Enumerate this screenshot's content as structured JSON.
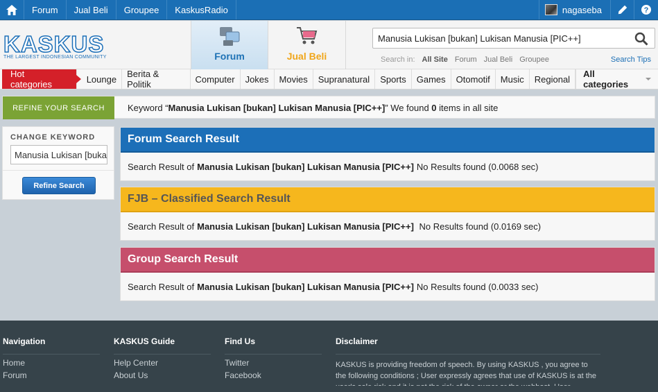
{
  "topbar": {
    "links": [
      "Forum",
      "Jual Beli",
      "Groupee",
      "KaskusRadio"
    ],
    "username": "nagaseba"
  },
  "header": {
    "logo_text": "KASKUS",
    "logo_tagline": "THE LARGEST INDONESIAN COMMUNITY",
    "tabs": [
      {
        "label": "Forum"
      },
      {
        "label": "Jual Beli"
      }
    ],
    "search": {
      "query": "Manusia Lukisan [bukan] Lukisan Manusia [PIC++]",
      "search_in_label": "Search in:",
      "options": [
        "All Site",
        "Forum",
        "Jual Beli",
        "Groupee"
      ],
      "tips": "Search Tips"
    }
  },
  "categories": {
    "hot": "Hot categories",
    "items": [
      "Lounge",
      "Berita & Politik",
      "Computer",
      "Jokes",
      "Movies",
      "Supranatural",
      "Sports",
      "Games",
      "Otomotif",
      "Music",
      "Regional"
    ],
    "all": "All categories"
  },
  "refine": {
    "label": "REFINE YOUR SEARCH",
    "prefix": "Keyword “",
    "keyword": "Manusia Lukisan [bukan] Lukisan Manusia [PIC++]",
    "mid": "” We found ",
    "count": "0",
    "suffix": " items in all site"
  },
  "sidebar": {
    "change_label": "CHANGE KEYWORD",
    "keyword_value": "Manusia Lukisan [bukan] Lukisan Manusia [PIC++]",
    "button": "Refine Search"
  },
  "results": [
    {
      "title": "Forum Search Result",
      "prefix": "Search Result of",
      "keyword": "Manusia Lukisan [bukan] Lukisan Manusia [PIC++]",
      "status": "No Results found (0.0068 sec)"
    },
    {
      "title": "FJB – Classified Search Result",
      "prefix": "Search Result of",
      "keyword": "Manusia Lukisan [bukan] Lukisan Manusia [PIC++]",
      "status": " No Results found (0.0169 sec)"
    },
    {
      "title": "Group Search Result",
      "prefix": "Search Result of",
      "keyword": "Manusia Lukisan [bukan] Lukisan Manusia [PIC++]",
      "status": "No Results found (0.0033 sec)"
    }
  ],
  "footer": {
    "navigation": {
      "heading": "Navigation",
      "links": [
        "Home",
        "Forum"
      ]
    },
    "guide": {
      "heading": "KASKUS Guide",
      "links": [
        "Help Center",
        "About Us"
      ]
    },
    "findus": {
      "heading": "Find Us",
      "links": [
        "Twitter",
        "Facebook"
      ]
    },
    "disclaimer": {
      "heading": "Disclaimer",
      "text": "KASKUS is providing freedom of speech. By using KASKUS , you agree to the following conditions ; User expressly agrees that use of KASKUS is at the user's sole risk and it is not the risk of the owner or the webhost. User"
    }
  },
  "colors": {
    "brand_blue": "#1c6fb8",
    "hot_red": "#d42029",
    "refine_green": "#7ba335",
    "fjb_yellow": "#f6b71d",
    "group_pink": "#c64f6c",
    "footer_dark": "#36434a"
  },
  "icons": [
    "home-icon",
    "pencil-icon",
    "help-icon",
    "search-icon",
    "forum-icon",
    "cart-icon"
  ]
}
